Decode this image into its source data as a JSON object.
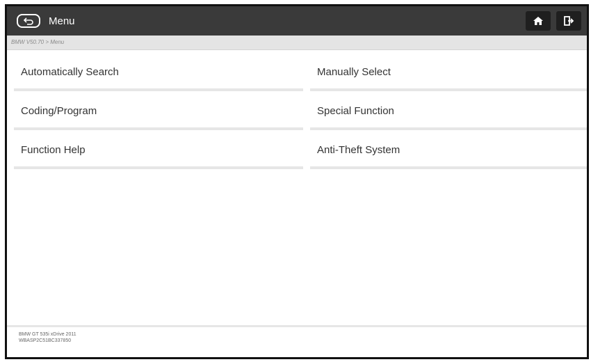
{
  "header": {
    "title": "Menu"
  },
  "breadcrumb": "BMW V50.70 > Menu",
  "menu": {
    "items": [
      {
        "label": "Automatically Search"
      },
      {
        "label": "Manually Select"
      },
      {
        "label": "Coding/Program"
      },
      {
        "label": "Special Function"
      },
      {
        "label": "Function Help"
      },
      {
        "label": "Anti-Theft System"
      }
    ]
  },
  "footer": {
    "vehicle": "BMW GT 535i xDrive 2011",
    "vin": "WBASP2C51BC337850"
  },
  "colors": {
    "topbar": "#3a3a3a",
    "button_bg": "#1f1f1f",
    "breadcrumb_bg": "#e4e4e4",
    "divider": "#e6e6e6"
  },
  "icons": [
    "back-icon",
    "home-icon",
    "exit-icon"
  ]
}
